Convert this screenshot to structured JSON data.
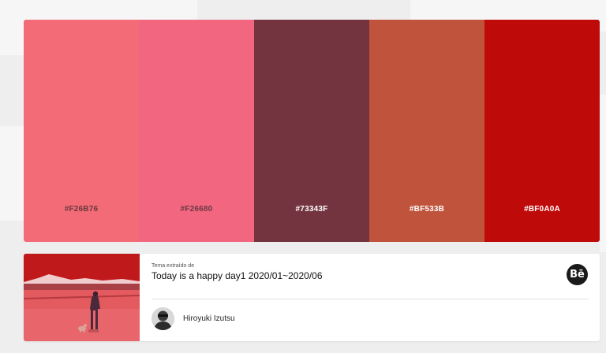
{
  "palette": {
    "swatches": [
      {
        "hex": "#F26B76",
        "color": "#F26B76",
        "label_color": "#6b3a3f"
      },
      {
        "hex": "#F26680",
        "color": "#F26680",
        "label_color": "#6b3a45"
      },
      {
        "hex": "#73343F",
        "color": "#73343F",
        "label_color": "#ffffff"
      },
      {
        "hex": "#BF533B",
        "color": "#BF533B",
        "label_color": "#ffffff"
      },
      {
        "hex": "#BF0A0A",
        "color": "#BF0A0A",
        "label_color": "#ffffff"
      }
    ]
  },
  "source": {
    "extracted_label": "Tema extraído de",
    "title": "Today is a happy day1 2020/01~2020/06",
    "platform_icon": "behance-icon",
    "platform_glyph": "Bē",
    "author_name": "Hiroyuki Izutsu",
    "thumbnail_icon": "artwork-thumbnail"
  }
}
